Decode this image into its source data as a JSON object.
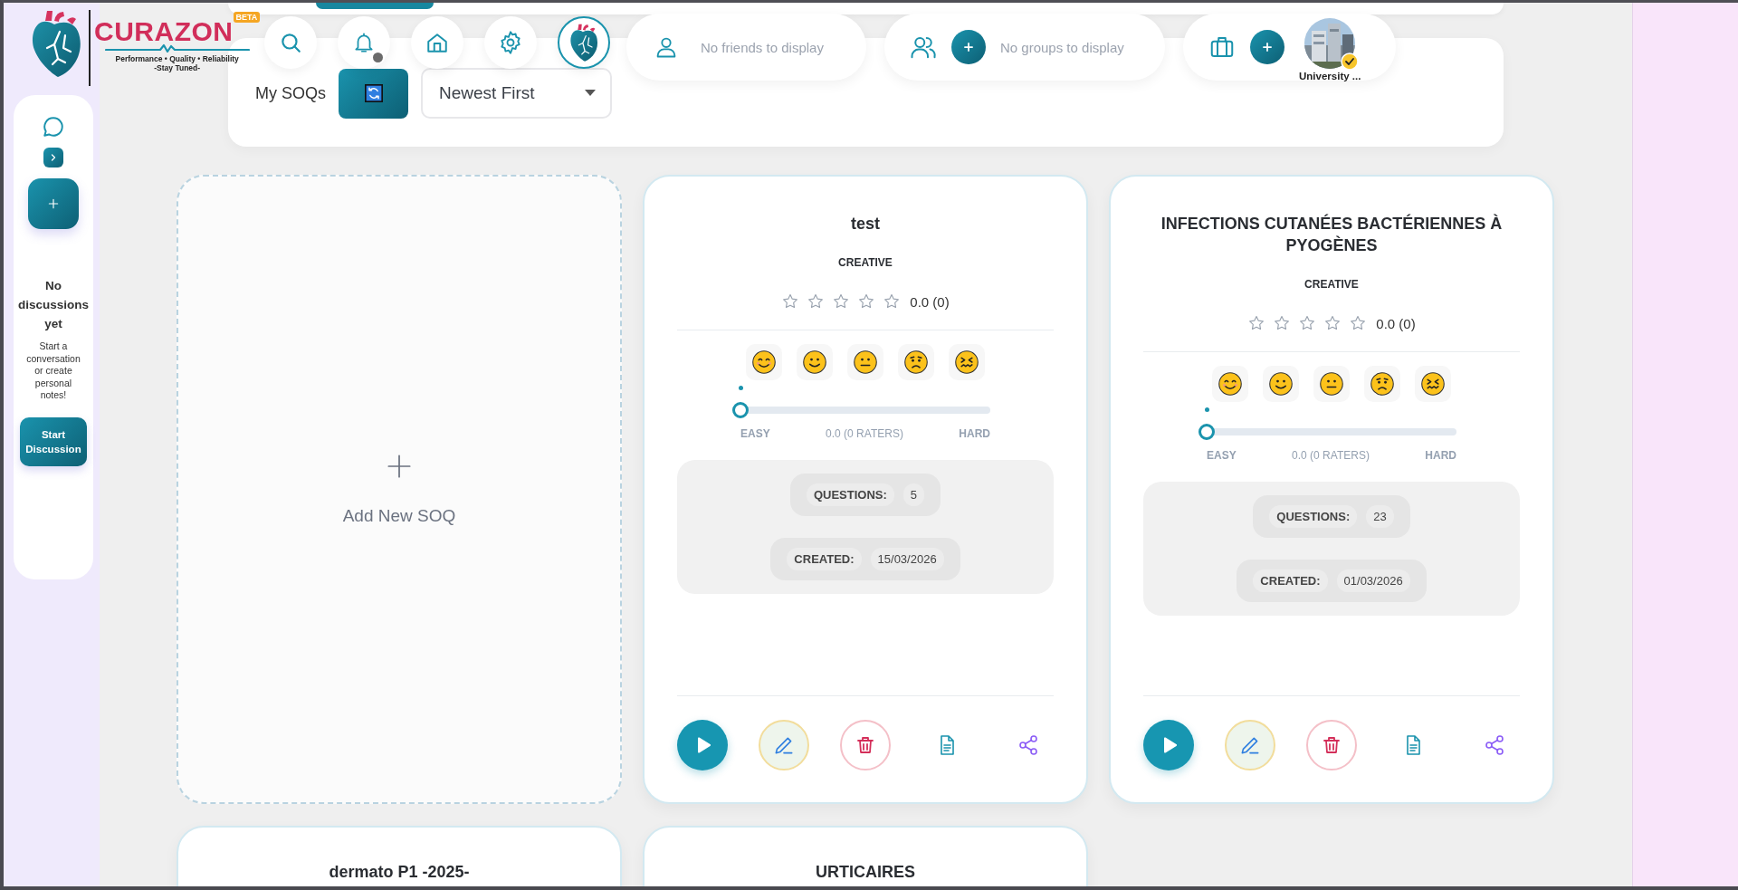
{
  "logo": {
    "name": "CURAZON",
    "badge": "BETA",
    "tagline": "Performance • Quality • Reliability",
    "motto": "-Stay Tuned-"
  },
  "toolbar": {
    "notifications_unread": true
  },
  "friends": {
    "empty_text": "No friends to display"
  },
  "groups": {
    "empty_text": "No groups to display"
  },
  "university": {
    "name": "University ...",
    "verified": true
  },
  "sidebar": {
    "title": "No discussions yet",
    "text": "Start a conversation or create personal notes!",
    "button": "Start Discussion"
  },
  "soq_bar": {
    "title": "My SOQs",
    "sort": "Newest First"
  },
  "cards": [
    {
      "kind": "add",
      "label": "Add New SOQ"
    },
    {
      "kind": "soq",
      "title": "test",
      "type": "CREATIVE",
      "stars": 0,
      "rating": "0.0 (0)",
      "difficulty": {
        "level": 0,
        "easy": "EASY",
        "reading": "0.0 (0 RATERS)",
        "hard": "HARD"
      },
      "stats": [
        {
          "label": "QUESTIONS:",
          "value": "5"
        },
        {
          "label": "CREATED:",
          "value": "15/03/2026"
        }
      ]
    },
    {
      "kind": "soq",
      "title": "INFECTIONS CUTANÉES BACTÉRIENNES À PYOGÈNES",
      "type": "CREATIVE",
      "stars": 0,
      "rating": "0.0 (0)",
      "difficulty": {
        "level": 0,
        "easy": "EASY",
        "reading": "0.0 (0 RATERS)",
        "hard": "HARD"
      },
      "stats": [
        {
          "label": "QUESTIONS:",
          "value": "23"
        },
        {
          "label": "CREATED:",
          "value": "01/03/2026"
        }
      ]
    },
    {
      "kind": "soq",
      "title": "dermato P1 -2025-"
    },
    {
      "kind": "soq",
      "title": "URTICAIRES"
    }
  ]
}
